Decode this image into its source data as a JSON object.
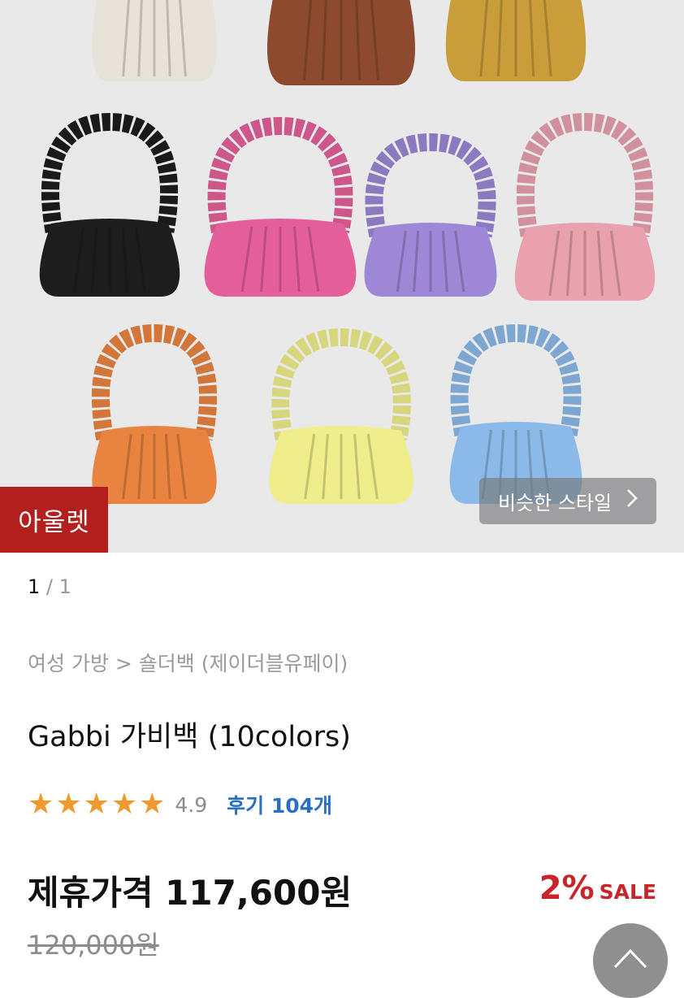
{
  "hero": {
    "badge": "아울렛",
    "similar_label": "비슷한 스타일",
    "similar_icon": "chevron-right-icon",
    "bag_colors": [
      "#e8e3d9",
      "#8e4a2e",
      "#c99e3a",
      "#1d1d1d",
      "#e45f9a",
      "#9c88d6",
      "#e8a1ad",
      "#e98340",
      "#efee8a",
      "#8bb9e8"
    ]
  },
  "pager": {
    "current": "1",
    "separator": " / ",
    "total": "1"
  },
  "breadcrumb": "여성 가방 > 숄더백 (제이더블유페이)",
  "product": {
    "title": "Gabbi 가비백 (10colors)",
    "rating": "4.9",
    "stars": 5,
    "reviews": "후기 104개",
    "price_label": "제휴가격 117,600원",
    "discount_pct": "2%",
    "discount_label": "SALE",
    "original_price": "120,000원"
  },
  "scroll_top_icon": "chevron-up-icon",
  "colors": {
    "badge": "#b31f1c",
    "star": "#ee9a2d",
    "review_link": "#2a6fc2",
    "sale": "#c8252a"
  }
}
